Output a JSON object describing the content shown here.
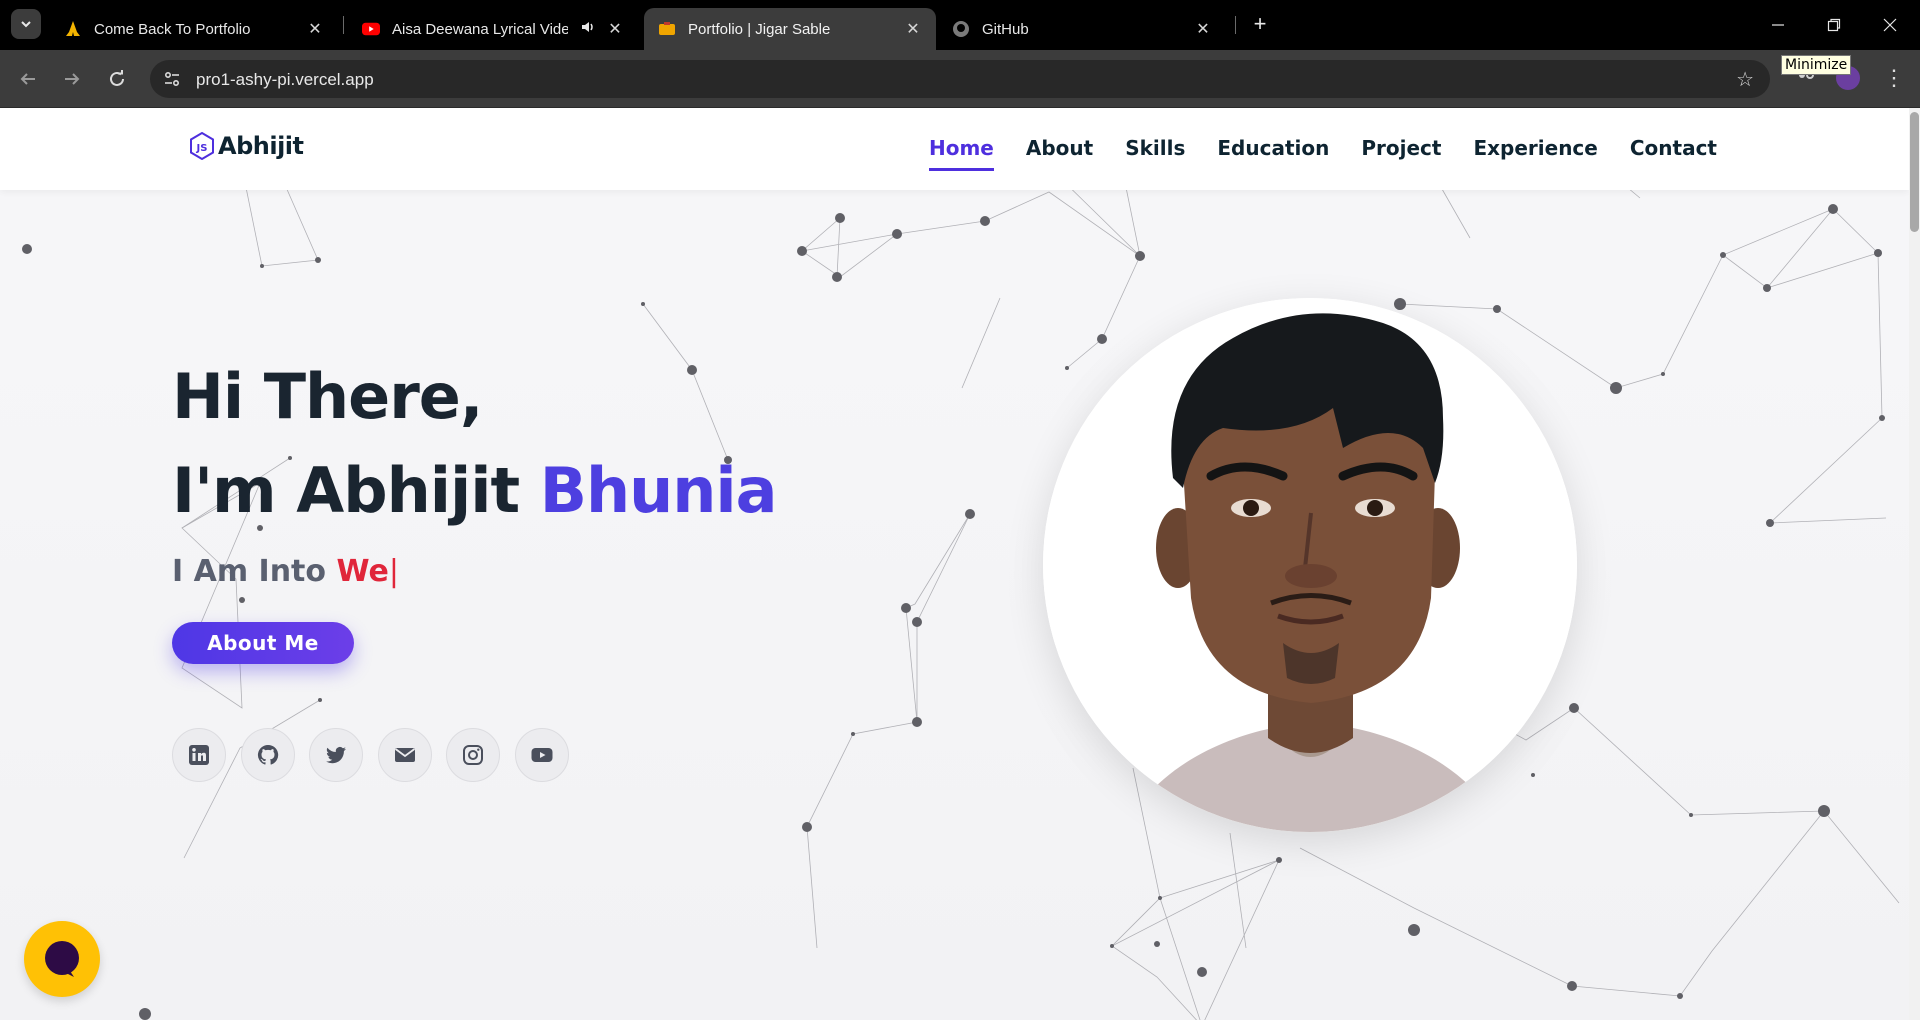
{
  "browser": {
    "tabs": [
      {
        "title": "Come Back To Portfolio",
        "favicon": "praying-hands-icon"
      },
      {
        "title": "Aisa Deewana Lyrical Video",
        "favicon": "youtube-icon",
        "audio": true
      },
      {
        "title": "Portfolio | Jigar Sable",
        "favicon": "portfolio-icon",
        "active": true
      },
      {
        "title": "GitHub",
        "favicon": "github-icon"
      }
    ],
    "url": "pro1-ashy-pi.vercel.app",
    "tooltip": "Minimize"
  },
  "navbar": {
    "brand": "Abhijit",
    "links": [
      "Home",
      "About",
      "Skills",
      "Education",
      "Project",
      "Experience",
      "Contact"
    ],
    "active": "Home"
  },
  "hero": {
    "line1": "Hi There,",
    "line2_prefix": "I'm Abhijit ",
    "line2_accent": "Bhunia",
    "typed_prefix": "I Am Into ",
    "typed_word": "We",
    "typed_cursor": "|",
    "button": "About Me",
    "socials": [
      "linkedin-icon",
      "github-icon",
      "twitter-icon",
      "envelope-icon",
      "instagram-icon",
      "youtube-icon"
    ]
  },
  "colors": {
    "accent": "#4d3fe0",
    "typed": "#e0263a",
    "chat": "#ffc105",
    "heading": "#1a2530"
  }
}
